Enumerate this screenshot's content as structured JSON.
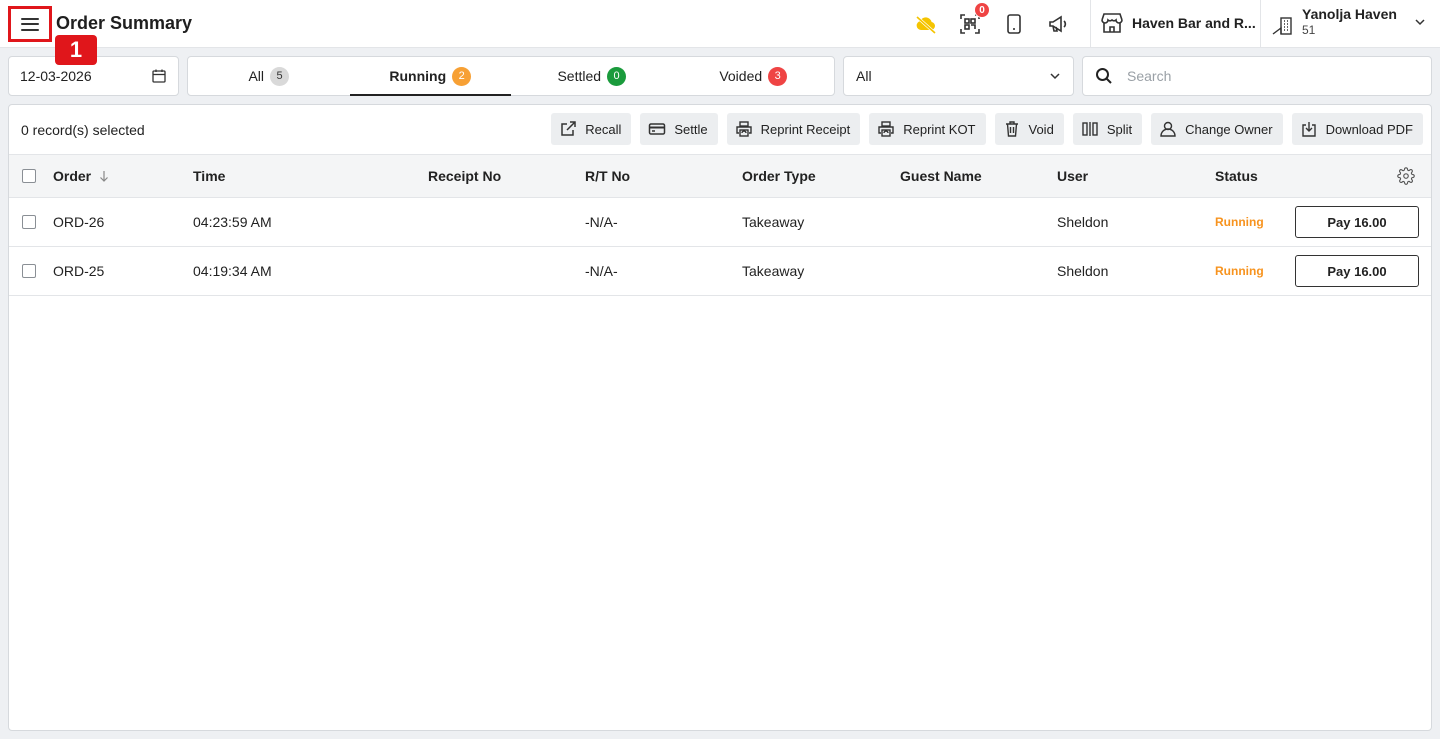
{
  "header": {
    "title": "Order Summary",
    "notification_count": "0",
    "outlet_name": "Haven Bar and R...",
    "property_name": "Yanolja Haven",
    "property_code": "51",
    "annotation_label": "1"
  },
  "filters": {
    "date": "12-03-2026",
    "tabs": [
      {
        "label": "All",
        "count": "5",
        "color": "#d9d9d9"
      },
      {
        "label": "Running",
        "count": "2",
        "color": "#f7a034"
      },
      {
        "label": "Settled",
        "count": "0",
        "color": "#1a9b3c"
      },
      {
        "label": "Voided",
        "count": "3",
        "color": "#ef4444"
      }
    ],
    "active_tab": "Running",
    "select_value": "All",
    "search_placeholder": "Search"
  },
  "toolbar": {
    "selected_text": "0 record(s) selected",
    "actions": [
      "Recall",
      "Settle",
      "Reprint Receipt",
      "Reprint KOT",
      "Void",
      "Split",
      "Change Owner",
      "Download PDF"
    ]
  },
  "table": {
    "columns": [
      "Order",
      "Time",
      "Receipt No",
      "R/T No",
      "Order Type",
      "Guest Name",
      "User",
      "Status"
    ],
    "rows": [
      {
        "order": "ORD-26",
        "time": "04:23:59 AM",
        "receipt_no": "",
        "rt_no": "-N/A-",
        "order_type": "Takeaway",
        "guest_name": "",
        "user": "Sheldon",
        "status": "Running",
        "action": "Pay 16.00"
      },
      {
        "order": "ORD-25",
        "time": "04:19:34 AM",
        "receipt_no": "",
        "rt_no": "-N/A-",
        "order_type": "Takeaway",
        "guest_name": "",
        "user": "Sheldon",
        "status": "Running",
        "action": "Pay 16.00"
      }
    ]
  },
  "colors": {
    "accent_running": "#f7931e",
    "annotation": "#e0161b"
  }
}
